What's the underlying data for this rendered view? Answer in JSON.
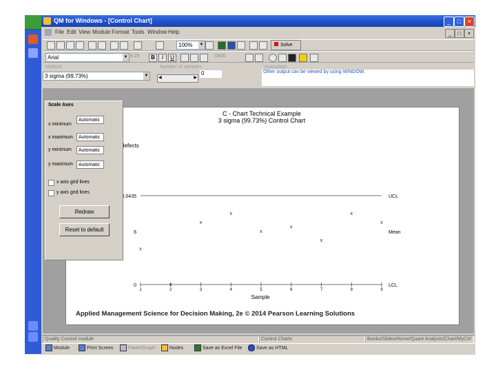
{
  "window": {
    "title": "QM for Windows - [Control Chart]",
    "min": "_",
    "max": "□",
    "close": "×"
  },
  "mdi": {
    "min": "_",
    "max": "□",
    "close": "×"
  },
  "menu": [
    "File",
    "Edit",
    "View",
    "Module",
    "Format",
    "Tools",
    "Window",
    "Help"
  ],
  "toolbar": {
    "font": "Arial",
    "font_size": "8.25",
    "solve_label": "Solve",
    "number_format": ".0000"
  },
  "params": {
    "method_label": "Method",
    "method_value": "3 sigma (99.73%)",
    "samples_label": "Number of samples",
    "samples_value": "0",
    "instruction_label": "Instruction",
    "instruction_text": "Other output can be viewed by using WINDOW."
  },
  "scale_axes": {
    "title": "Scale Axes",
    "fields": [
      {
        "label": "x minimum",
        "value": "Automatic"
      },
      {
        "label": "x maximum",
        "value": "Automatic"
      },
      {
        "label": "y minimum",
        "value": "Automatic"
      },
      {
        "label": "y maximum",
        "value": "Automatic"
      }
    ],
    "x_grid_label": "x axis grid lines",
    "y_grid_label": "y axis grid lines",
    "redraw": "Redraw",
    "reset": "Reset to default"
  },
  "chart_data": {
    "type": "line",
    "title": "C - Chart Technical Example",
    "subtitle": "3 sigma (99.73%) Control Chart",
    "ylabel": "defects",
    "xlabel": "Sample",
    "y_tick_labels": [
      "10.0435",
      "6",
      "0"
    ],
    "line_labels": [
      "UCL",
      "Mean",
      "LCL"
    ],
    "ucl": 10.0435,
    "center": 6,
    "lcl": 0,
    "ylim": [
      0,
      10.0435
    ],
    "x": [
      1,
      2,
      3,
      4,
      5,
      6,
      7,
      8,
      9
    ],
    "x_tick_labels": [
      "1",
      "2",
      "3",
      "4",
      "5",
      "6",
      "7",
      "8",
      "9"
    ],
    "series": [
      {
        "values": [
          4,
          0,
          7,
          8,
          6,
          6.5,
          5,
          8,
          7
        ]
      }
    ]
  },
  "copyright": "Applied Management Science for Decision Making, 2e © 2014 Pearson Learning Solutions",
  "status": {
    "left": "Quality Control module",
    "mid": "Control Charts",
    "right": "Books/Slides/Home/Quant Analysis/Chart/MyCtrl"
  },
  "taskbar": [
    {
      "label": "Module"
    },
    {
      "label": "Print Screen"
    },
    {
      "label": "Paste/Graph"
    },
    {
      "label": "Nodes"
    },
    {
      "label": "Save as Excel File"
    },
    {
      "label": "Save as HTML"
    }
  ]
}
